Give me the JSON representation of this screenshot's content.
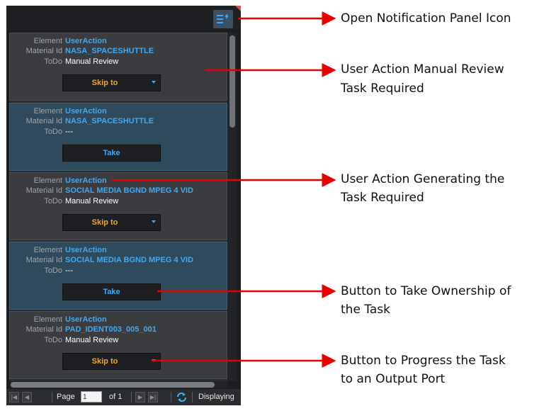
{
  "panel": {
    "cards": [
      {
        "element_label": "Element",
        "element_value": "UserAction",
        "material_label": "Material Id",
        "material_value": "NASA_SPACESHUTTLE",
        "todo_label": "ToDo",
        "todo_value": "Manual Review",
        "button": "Skip to",
        "button_kind": "skip",
        "style": "dark"
      },
      {
        "element_label": "Element",
        "element_value": "UserAction",
        "material_label": "Material Id",
        "material_value": "NASA_SPACESHUTTLE",
        "todo_label": "ToDo",
        "todo_value": "---",
        "button": "Take",
        "button_kind": "take",
        "style": "teal"
      },
      {
        "element_label": "Element",
        "element_value": "UserAction",
        "material_label": "Material Id",
        "material_value": "SOCIAL MEDIA BGND MPEG 4 VID",
        "todo_label": "ToDo",
        "todo_value": "Manual Review",
        "button": "Skip to",
        "button_kind": "skip",
        "style": "dark"
      },
      {
        "element_label": "Element",
        "element_value": "UserAction",
        "material_label": "Material Id",
        "material_value": "SOCIAL MEDIA BGND MPEG 4 VID",
        "todo_label": "ToDo",
        "todo_value": "---",
        "button": "Take",
        "button_kind": "take",
        "style": "teal"
      },
      {
        "element_label": "Element",
        "element_value": "UserAction",
        "material_label": "Material Id",
        "material_value": "PAD_IDENT003_005_001",
        "todo_label": "ToDo",
        "todo_value": "Manual Review",
        "button": "Skip to",
        "button_kind": "skip",
        "style": "dark"
      }
    ],
    "pager": {
      "page_label": "Page",
      "page_value": "1",
      "of_label": "of 1",
      "displaying": "Displaying"
    },
    "icons": {
      "notify": "notification-list-icon",
      "first": "first-page-icon",
      "prev": "previous-page-icon",
      "next": "next-page-icon",
      "last": "last-page-icon",
      "refresh": "refresh-icon"
    },
    "colors": {
      "accent_blue": "#3fa9f5",
      "skip_orange": "#f0a830",
      "arrow_red": "#e60000"
    }
  },
  "annotations": {
    "notify_panel": "Open Notification Panel Icon",
    "manual_review_1": "User Action Manual Review",
    "manual_review_2": "Task Required",
    "generating_1": "User Action Generating the",
    "generating_2": "Task Required",
    "take_1": "Button to Take Ownership of",
    "take_2": "the Task",
    "progress_1": "Button to Progress the Task",
    "progress_2": "to an Output Port"
  }
}
